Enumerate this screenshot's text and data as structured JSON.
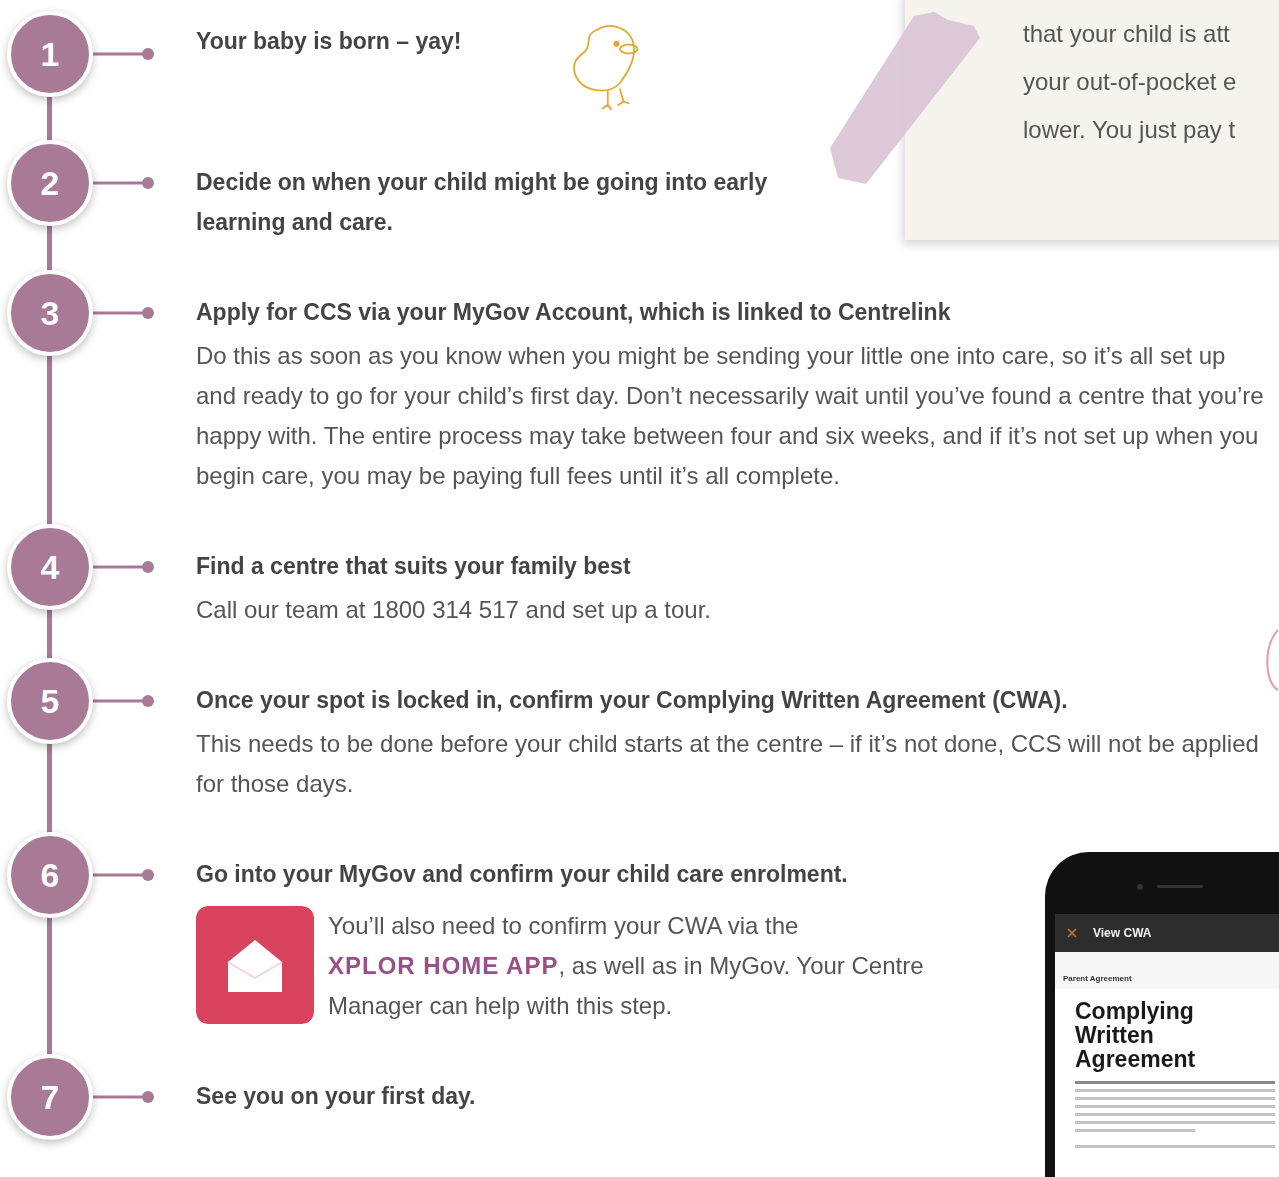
{
  "note": {
    "lines": [
      "that your child is att",
      "your out-of-pocket e",
      "lower. You just pay t"
    ]
  },
  "steps": [
    {
      "number": "1",
      "kind": "illustrated",
      "title": "Your baby is born – yay!"
    },
    {
      "number": "2",
      "kind": "plain",
      "title": "Decide on when your child might be going into early learning and care."
    },
    {
      "number": "3",
      "kind": "plain",
      "title": "Apply for CCS via your MyGov Account, which is linked to Centrelink",
      "body": "Do this as soon as you know when you might be sending your little one into care, so it’s all set up and ready to go for your child’s first day. Don’t necessarily wait until you’ve found a centre that you’re happy with. The entire process may take between four and six weeks, and if it’s not set up when you begin care, you may be paying full fees until it’s all complete."
    },
    {
      "number": "4",
      "kind": "plain",
      "title": "Find a centre that suits your family best",
      "body": "Call our team at 1800 314 517 and set up a tour."
    },
    {
      "number": "5",
      "kind": "plain",
      "title": "Once your spot is locked in, confirm your Complying Written Agreement (CWA).",
      "body": "This needs to be done before your child starts at the centre – if it’s not done, CCS will not be applied for those days."
    },
    {
      "number": "6",
      "kind": "app_note",
      "title": "Go into your MyGov and confirm your child care enrolment.",
      "note": {
        "text_before": "You’ll also need to confirm your CWA via the",
        "link": "XPLOR HOME APP",
        "text_after": ", as well as in MyGov. Your Centre Manager can help with this step."
      }
    },
    {
      "number": "7",
      "kind": "plain",
      "title": "See you on your first day."
    }
  ],
  "phone": {
    "header": "View CWA",
    "section": "Parent Agreement",
    "heading": "Complying Written Agreement"
  }
}
